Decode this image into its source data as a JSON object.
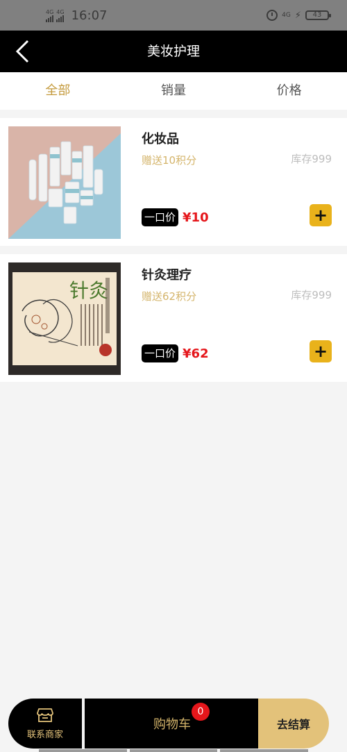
{
  "status_bar": {
    "net1": "4G",
    "net2": "4G",
    "time": "16:07",
    "net3": "4G",
    "battery": "43"
  },
  "header": {
    "title": "美妆护理"
  },
  "tabs": [
    {
      "label": "全部",
      "active": true
    },
    {
      "label": "销量",
      "active": false
    },
    {
      "label": "价格",
      "active": false
    }
  ],
  "products": [
    {
      "name": "化妆品",
      "points": "赠送10积分",
      "stock": "库存999",
      "price_tag": "一口价",
      "price": "¥10"
    },
    {
      "name": "针灸理疗",
      "points": "赠送62积分",
      "stock": "库存999",
      "price_tag": "一口价",
      "price": "¥62",
      "image_text": "针灸"
    }
  ],
  "bottom_bar": {
    "contact_label": "联系商家",
    "cart_label": "购物车",
    "cart_count": "0",
    "checkout_label": "去结算"
  },
  "colors": {
    "accent_gold": "#c49a3c",
    "price_red": "#e5161b",
    "add_button": "#e9b21b",
    "checkout_bg": "#e3c27a"
  }
}
